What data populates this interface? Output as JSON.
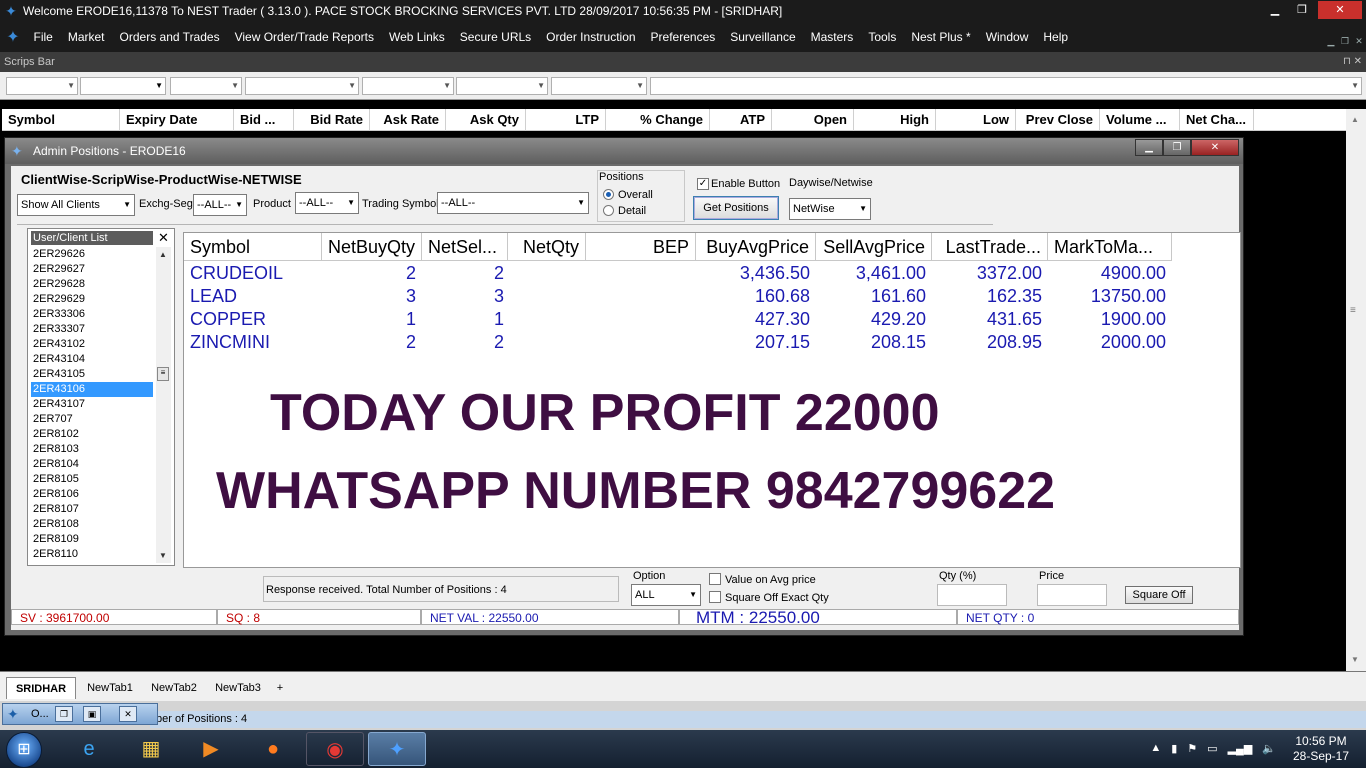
{
  "app": {
    "title": "Welcome ERODE16,11378 To NEST Trader ( 3.13.0 ).  PACE STOCK BROCKING SERVICES PVT. LTD  28/09/2017  10:56:35 PM - [SRIDHAR]",
    "win_min": "▁",
    "win_max": "❐",
    "win_close": "✕"
  },
  "menu": [
    "File",
    "Market",
    "Orders and Trades",
    "View Order/Trade Reports",
    "Web Links",
    "Secure URLs",
    "Order Instruction",
    "Preferences",
    "Surveillance",
    "Masters",
    "Tools",
    "Nest Plus *",
    "Window",
    "Help"
  ],
  "menu_ctl": [
    "▁",
    "❐",
    "✕"
  ],
  "scrips_bar": {
    "title": "Scrips Bar",
    "ctl": "⊓  ✕"
  },
  "market_watch": {
    "columns": [
      "Symbol",
      "Expiry Date",
      "Bid ...",
      "Bid Rate",
      "Ask Rate",
      "Ask Qty",
      "LTP",
      "% Change",
      "ATP",
      "Open",
      "High",
      "Low",
      "Prev Close",
      "Volume ...",
      "Net Cha..."
    ]
  },
  "positions_window": {
    "title": "Admin Positions - ERODE16",
    "heading": "ClientWise-ScripWise-ProductWise-NETWISE",
    "clients_select": "Show All Clients",
    "exchg_label": "Exchg-Seg",
    "exchg_value": "--ALL--",
    "product_label": "Product",
    "product_value": "--ALL--",
    "trading_symbol_label": "Trading Symbol",
    "trading_symbol_value": "--ALL--",
    "positions_label": "Positions",
    "radio_overall": "Overall",
    "radio_detail": "Detail",
    "enable_button_label": "Enable Button",
    "daywise_label": "Daywise/Netwise",
    "get_positions": "Get Positions",
    "netwise_value": "NetWise",
    "user_list_title": "User/Client List",
    "user_list_close": "✕",
    "users": [
      "2ER29626",
      "2ER29627",
      "2ER29628",
      "2ER29629",
      "2ER33306",
      "2ER33307",
      "2ER43102",
      "2ER43104",
      "2ER43105",
      "2ER43106",
      "2ER43107",
      "2ER707",
      "2ER8102",
      "2ER8103",
      "2ER8104",
      "2ER8105",
      "2ER8106",
      "2ER8107",
      "2ER8108",
      "2ER8109",
      "2ER8110"
    ],
    "selected_user": "2ER43106",
    "grid_columns": [
      "Symbol",
      "NetBuyQty",
      "NetSel...",
      "NetQty",
      "BEP",
      "BuyAvgPrice",
      "SellAvgPrice",
      "LastTrade...",
      "MarkToMa..."
    ],
    "rows": [
      [
        "CRUDEOIL",
        "2",
        "2",
        "",
        "",
        "3,436.50",
        "3,461.00",
        "3372.00",
        "4900.00"
      ],
      [
        "LEAD",
        "3",
        "3",
        "",
        "",
        "160.68",
        "161.60",
        "162.35",
        "13750.00"
      ],
      [
        "COPPER",
        "1",
        "1",
        "",
        "",
        "427.30",
        "429.20",
        "431.65",
        "1900.00"
      ],
      [
        "ZINCMINI",
        "2",
        "2",
        "",
        "",
        "207.15",
        "208.15",
        "208.95",
        "2000.00"
      ]
    ],
    "promo_line1": "TODAY  OUR  PROFIT 22000",
    "promo_line2": "WHATSAPP NUMBER 9842799622",
    "status_message": "Response received. Total Number of Positions : 4",
    "option_label": "Option",
    "option_value": "ALL",
    "value_on_avg_price": "Value on Avg  price",
    "square_off_exact_qty": "Square Off Exact Qty",
    "qty_pct_label": "Qty (%)",
    "price_label": "Price",
    "square_off_button": "Square Off",
    "summary": {
      "sv": "SV : 3961700.00",
      "sq": "SQ : 8",
      "net_val": "NET VAL : 22550.00",
      "mtm": "MTM : 22550.00",
      "net_qty": "NET QTY : 0"
    }
  },
  "tabs": [
    "SRIDHAR",
    "NewTab1",
    "NewTab2",
    "NewTab3",
    "+"
  ],
  "bottom_status": "ber of Positions : 4",
  "minimized_window": {
    "title": "O...",
    "btn1": "❐",
    "btn2": "▣",
    "btn3": "✕"
  },
  "taskbar": {
    "clock_time": "10:56 PM",
    "clock_date": "28-Sep-17",
    "tray_icons": [
      "▲",
      "🔈"
    ]
  },
  "colors": {
    "grid_text": "#1a1ab0",
    "promo_text": "#3f0e42",
    "summary_red": "#c00000",
    "summary_blue": "#1a1ab0",
    "selected_blue": "#3399ff"
  },
  "icons": {
    "app": "nest-puzzle-icon",
    "start": "windows-start-icon",
    "ie": "internet-explorer-icon",
    "explorer": "file-explorer-icon",
    "media": "media-player-icon",
    "firefox": "firefox-icon",
    "chrome": "chrome-icon",
    "nest": "nest-trader-icon"
  }
}
